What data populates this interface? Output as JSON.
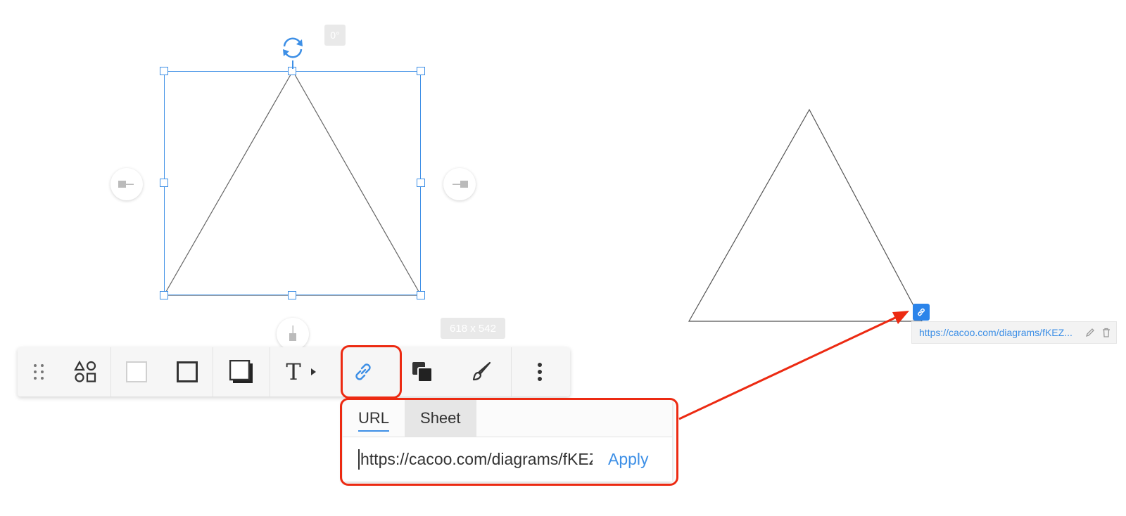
{
  "canvas": {
    "rotation_label": "0°",
    "size_label": "618 x 542"
  },
  "toolbar": {
    "items": [
      {
        "name": "drag-handle-icon"
      },
      {
        "name": "shapes-icon"
      },
      {
        "name": "fill-color-icon"
      },
      {
        "name": "line-style-icon"
      },
      {
        "name": "shadow-icon"
      },
      {
        "name": "text-icon",
        "label": "T"
      },
      {
        "name": "link-icon"
      },
      {
        "name": "arrange-icon"
      },
      {
        "name": "style-brush-icon"
      },
      {
        "name": "more-options-icon"
      }
    ]
  },
  "link_popover": {
    "tabs": [
      {
        "label": "URL",
        "active": true
      },
      {
        "label": "Sheet",
        "active": false
      }
    ],
    "url_value": "https://cacoo.com/diagrams/fKEZ",
    "apply_label": "Apply"
  },
  "link_chip": {
    "url_text": "https://cacoo.com/diagrams/fKEZ..."
  },
  "colors": {
    "accent": "#3d8fe6",
    "annotation_red": "#ec2a12"
  }
}
